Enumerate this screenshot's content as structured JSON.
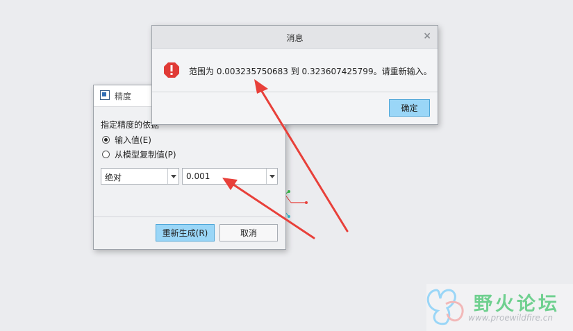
{
  "precision_dialog": {
    "title": "精度",
    "group_label": "指定精度的依据",
    "radio_options": [
      {
        "label": "输入值(E)",
        "checked": true
      },
      {
        "label": "从模型复制值(P)",
        "checked": false
      }
    ],
    "mode_select": {
      "value": "绝对"
    },
    "value_combo": {
      "value": "0.001"
    },
    "regenerate_label": "重新生成(R)",
    "cancel_label": "取消"
  },
  "message_dialog": {
    "title": "消息",
    "close_glyph": "×",
    "message": "范围为 0.003235750683 到 0.323607425799。请重新输入。",
    "ok_label": "确定",
    "icon": "error-icon"
  },
  "annotations": {
    "arrow_color": "#e8403a"
  },
  "watermark": {
    "title": "野火论坛",
    "url": "www.proewildfire.cn",
    "icon": "butterfly-logo"
  },
  "colors": {
    "background": "#ebecef",
    "primary_button": "#9ad6f7",
    "error_red": "#e03a36"
  }
}
